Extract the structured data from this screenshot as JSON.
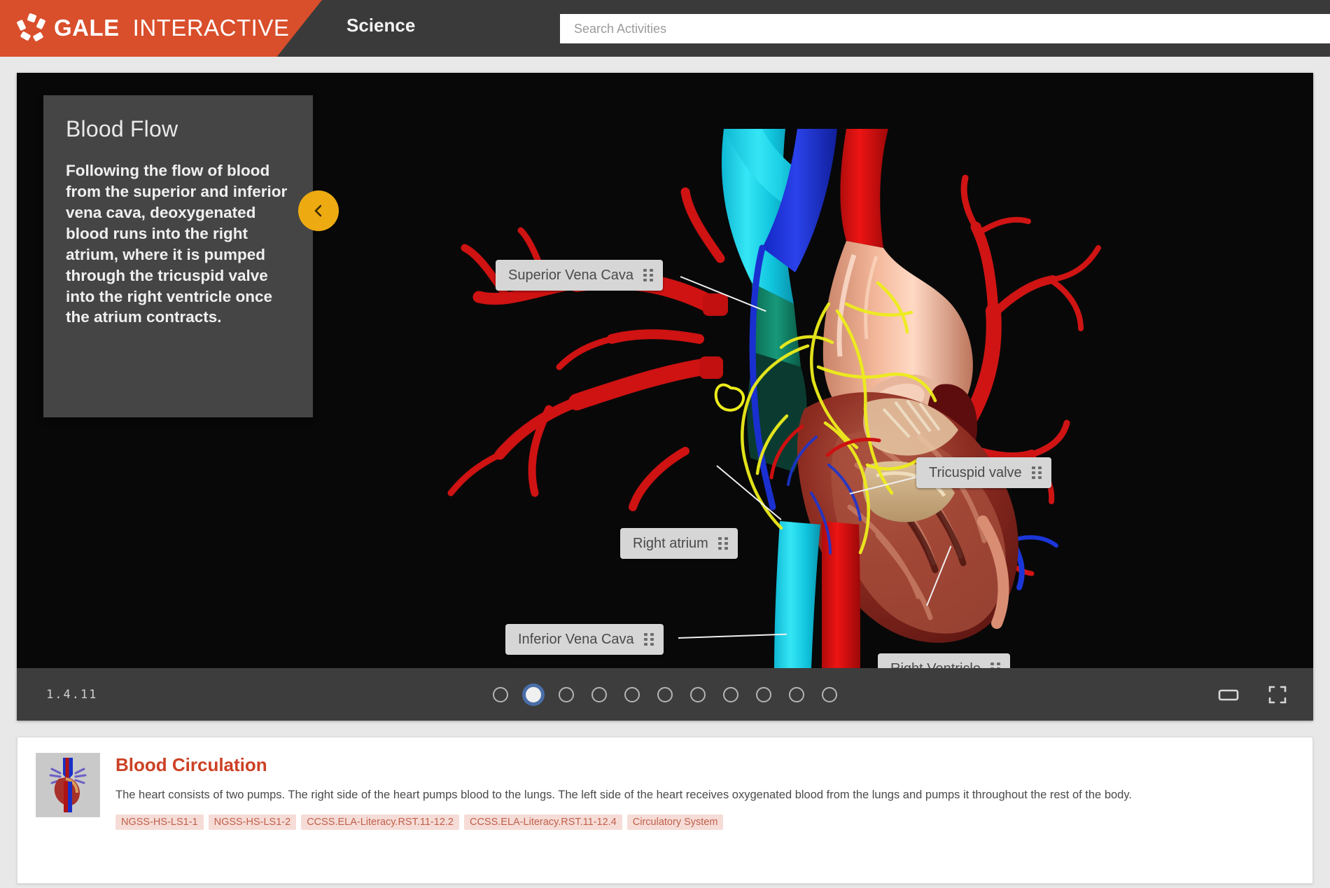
{
  "header": {
    "brand_primary": "GALE",
    "brand_secondary": "INTERACTIVE",
    "subject": "Science",
    "brand_color": "#d94e2b",
    "logo_icon": "gale-starburst-icon",
    "search": {
      "placeholder": "Search Activities",
      "value": "",
      "icon": "search-icon"
    }
  },
  "viewer": {
    "prev_arrow": "‹",
    "next_arrow": "›",
    "info_panel": {
      "title": "Blood Flow",
      "body": "Following the flow of blood from the superior and inferior vena cava, deoxygenated blood runs into the right atrium, where it is pumped through the tricuspid valve into the right ventricle once the atrium contracts.",
      "collapse_icon": "chevron-left-icon",
      "collapse_color": "#edaa11"
    },
    "callouts": [
      {
        "label": "Superior Vena Cava",
        "grip_icon": "drag-grip-icon"
      },
      {
        "label": "Tricuspid valve",
        "grip_icon": "drag-grip-icon"
      },
      {
        "label": "Right atrium",
        "grip_icon": "drag-grip-icon"
      },
      {
        "label": "Inferior Vena Cava",
        "grip_icon": "drag-grip-icon"
      },
      {
        "label": "Right Ventricle",
        "grip_icon": "drag-grip-icon"
      }
    ]
  },
  "toolbar": {
    "version": "1.4.11",
    "total_slides": 11,
    "active_slide": 2,
    "widescreen_icon": "widescreen-icon",
    "fullscreen_icon": "fullscreen-icon"
  },
  "activity_card": {
    "thumbnail_icon": "heart-thumbnail",
    "title": "Blood Circulation",
    "description": "The heart consists of two pumps. The right side of the heart pumps blood to the lungs. The left side of the heart receives oxygenated blood from the lungs and pumps it throughout the rest of the body.",
    "tags": [
      "NGSS-HS-LS1-1",
      "NGSS-HS-LS1-2",
      "CCSS.ELA-Literacy.RST.11-12.2",
      "CCSS.ELA-Literacy.RST.11-12.4",
      "Circulatory System"
    ]
  }
}
